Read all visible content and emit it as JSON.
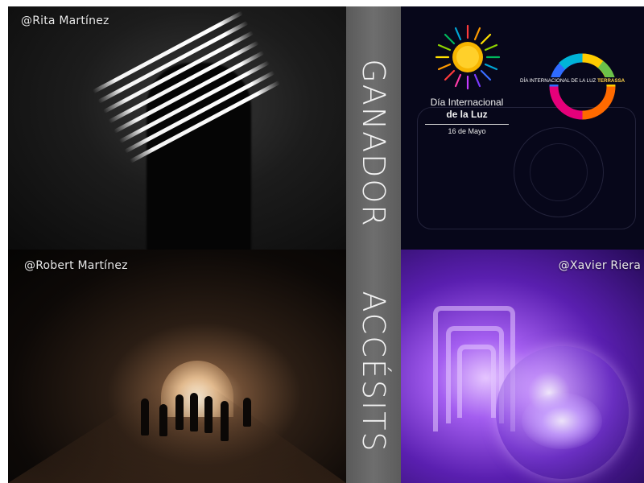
{
  "credits": {
    "top_left": "@Rita Martínez",
    "bottom_left": "@Robert Martínez",
    "bottom_right": "@Xavier Riera"
  },
  "labels": {
    "winner": "GANADOR",
    "runners_up": "ACCÉSITS"
  },
  "logo": {
    "title_line1": "Día Internacional",
    "title_line2": "de la Luz",
    "date": "16 de Mayo",
    "ring_text": "DÍA INTERNACIONAL DE LA LUZ",
    "ring_city": "TERRASSA"
  },
  "colors": {
    "logo_background": "#07071a",
    "label_column": "#666666",
    "sun": "#f7b500",
    "xavier_purple": "#8a3ee8"
  }
}
